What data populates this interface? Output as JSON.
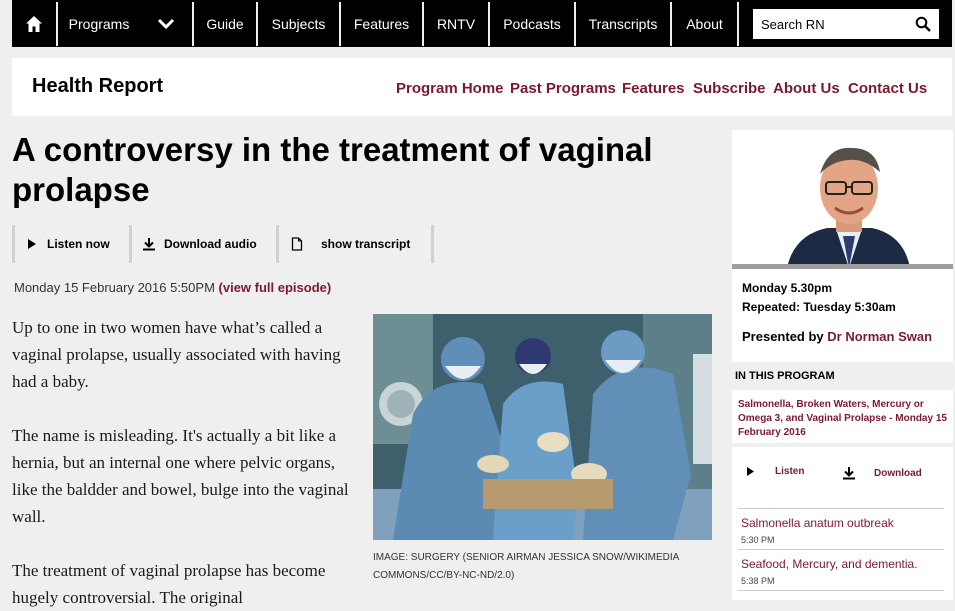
{
  "nav": {
    "home_icon": "home-icon",
    "items": [
      {
        "label": "Programs"
      },
      {
        "label": "Guide"
      },
      {
        "label": "Subjects"
      },
      {
        "label": "Features"
      },
      {
        "label": "RNTV"
      },
      {
        "label": "Podcasts"
      },
      {
        "label": "Transcripts"
      },
      {
        "label": "About"
      }
    ],
    "search": {
      "value": "Search RN",
      "icon": "search-icon"
    }
  },
  "program": {
    "title": "Health Report",
    "links": [
      "Program Home",
      "Past Programs",
      "Features",
      "Subscribe",
      "About Us",
      "Contact Us"
    ]
  },
  "article": {
    "headline": "A controversy in the treatment of vaginal prolapse",
    "player": {
      "listen": "Listen now",
      "download": "Download audio",
      "transcript": "show transcript"
    },
    "date": "Monday 15 February 2016 5:50PM",
    "episode_link": "(view full episode)",
    "paragraphs": [
      "Up to one in two women have what’s called a vaginal prolapse, usually associated with having had a baby.",
      "The name is misleading. It's actually a bit like a hernia, but an internal one where pelvic organs, like the baldder and bowel, bulge into the vaginal wall.",
      "The treatment of vaginal prolapse has become hugely controversial. The original"
    ],
    "image_caption": "IMAGE: SURGERY (SENIOR AIRMAN JESSICA SNOW/WIKIMEDIA COMMONS/CC/BY-NC-ND/2.0)"
  },
  "sidebar": {
    "schedule": "Monday 5.30pm",
    "repeat": "Repeated: Tuesday 5:30am",
    "presented_label": "Presented by",
    "presenter": "Dr Norman Swan",
    "in_program": "IN THIS PROGRAM",
    "episode_title": "Salmonella, Broken Waters, Mercury or Omega 3, and Vaginal Prolapse - Monday 15 February 2016",
    "listen": "Listen",
    "download": "Download",
    "segments": [
      {
        "title": "Salmonella anatum outbreak",
        "time": "5:30 PM"
      },
      {
        "title": "Seafood, Mercury, and dementia.",
        "time": "5:38 PM"
      }
    ]
  },
  "colors": {
    "accent": "#7a1a2d",
    "nav_bg": "#000000",
    "page_bg": "#efefef"
  }
}
